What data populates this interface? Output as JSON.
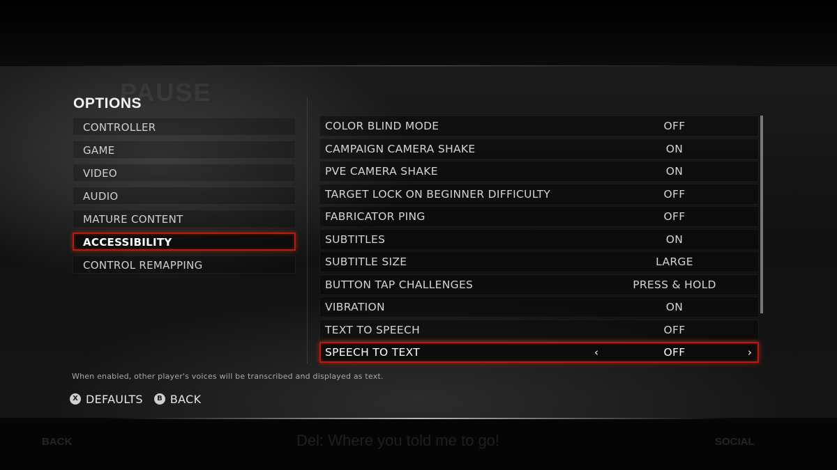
{
  "header": {
    "title": "OPTIONS"
  },
  "categories": [
    {
      "label": "CONTROLLER",
      "selected": false
    },
    {
      "label": "GAME",
      "selected": false
    },
    {
      "label": "VIDEO",
      "selected": false
    },
    {
      "label": "AUDIO",
      "selected": false
    },
    {
      "label": "MATURE CONTENT",
      "selected": false
    },
    {
      "label": "ACCESSIBILITY",
      "selected": true
    },
    {
      "label": "CONTROL REMAPPING",
      "selected": false
    }
  ],
  "settings": [
    {
      "label": "COLOR BLIND MODE",
      "value": "OFF"
    },
    {
      "label": "CAMPAIGN CAMERA SHAKE",
      "value": "ON"
    },
    {
      "label": "PVE CAMERA SHAKE",
      "value": "ON"
    },
    {
      "label": "TARGET LOCK ON BEGINNER DIFFICULTY",
      "value": "OFF"
    },
    {
      "label": "FABRICATOR PING",
      "value": "OFF"
    },
    {
      "label": "SUBTITLES",
      "value": "ON"
    },
    {
      "label": "SUBTITLE SIZE",
      "value": "LARGE"
    },
    {
      "label": "BUTTON TAP CHALLENGES",
      "value": "PRESS & HOLD"
    },
    {
      "label": "VIBRATION",
      "value": "ON"
    },
    {
      "label": "TEXT TO SPEECH",
      "value": "OFF"
    },
    {
      "label": "SPEECH TO TEXT",
      "value": "OFF",
      "selected": true
    }
  ],
  "arrows": {
    "left": "‹",
    "right": "›"
  },
  "description": "When enabled, other player's voices will be transcribed and displayed as text.",
  "footer": {
    "defaults": {
      "glyph": "X",
      "label": "DEFAULTS"
    },
    "back": {
      "glyph": "B",
      "label": "BACK"
    }
  },
  "background": {
    "ghost_pause": "PAUSE",
    "ghost_back": "BACK",
    "ghost_social": "SOCIAL",
    "ghost_subtitle": "Del: Where you told me to go!"
  },
  "colors": {
    "highlight_border": "#b51c10",
    "text": "#d4d4d4",
    "selected_text": "#ffffff"
  }
}
